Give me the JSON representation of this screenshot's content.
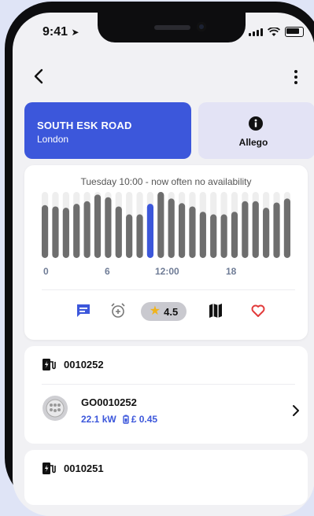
{
  "status_bar": {
    "time": "9:41"
  },
  "station": {
    "name": "SOUTH ESK ROAD",
    "city": "London"
  },
  "operator": {
    "name": "Allego"
  },
  "occupancy": {
    "label": "Tuesday 10:00 - now often no availability",
    "ticks": [
      "0",
      "6",
      "12:00",
      "18"
    ],
    "current_hour_index": 7
  },
  "chart_data": {
    "type": "bar",
    "categories": [
      "0",
      "1",
      "2",
      "3",
      "4",
      "5",
      "6",
      "7",
      "8",
      "9",
      "10",
      "11",
      "12",
      "13",
      "14",
      "15",
      "16",
      "17",
      "18",
      "19",
      "20",
      "21",
      "22",
      "23"
    ],
    "values": [
      0.8,
      0.78,
      0.76,
      0.82,
      0.86,
      0.96,
      0.92,
      0.78,
      0.66,
      0.66,
      0.82,
      1.0,
      0.9,
      0.83,
      0.78,
      0.7,
      0.66,
      0.66,
      0.7,
      0.86,
      0.86,
      0.76,
      0.84,
      0.9
    ],
    "highlight_index": 10,
    "colors": {
      "bar": "#6e6e6e",
      "highlight": "#3c57db",
      "track": "#eeeeee"
    }
  },
  "actions": {
    "rating": "4.5"
  },
  "chargers": [
    {
      "group_id": "0010252",
      "evse_id": "GO0010252",
      "power": "22.1 kW",
      "price": "£ 0.45"
    },
    {
      "group_id": "0010251"
    }
  ],
  "colors": {
    "accent": "#3c57db",
    "heart": "#e23b3b"
  }
}
